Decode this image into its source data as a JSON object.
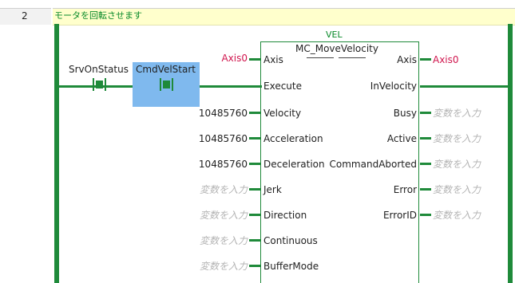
{
  "rung": {
    "number": "2",
    "comment": "モータを回転させます"
  },
  "contacts": [
    {
      "name": "SrvOnStatus",
      "selected": false
    },
    {
      "name": "CmdVelStart",
      "selected": true
    }
  ],
  "function_block": {
    "category": "VEL",
    "name": "MC_MoveVelocity",
    "inputs": [
      {
        "label": "Axis",
        "value": "Axis0",
        "kind": "axis"
      },
      {
        "label": "Execute",
        "value": "",
        "kind": "wire"
      },
      {
        "label": "Velocity",
        "value": "10485760",
        "kind": "value"
      },
      {
        "label": "Acceleration",
        "value": "10485760",
        "kind": "value"
      },
      {
        "label": "Deceleration",
        "value": "10485760",
        "kind": "value"
      },
      {
        "label": "Jerk",
        "value": "変数を入力",
        "kind": "placeholder"
      },
      {
        "label": "Direction",
        "value": "変数を入力",
        "kind": "placeholder"
      },
      {
        "label": "Continuous",
        "value": "変数を入力",
        "kind": "placeholder"
      },
      {
        "label": "BufferMode",
        "value": "変数を入力",
        "kind": "placeholder"
      }
    ],
    "outputs": [
      {
        "label": "Axis",
        "value": "Axis0",
        "kind": "axis"
      },
      {
        "label": "InVelocity",
        "value": "",
        "kind": "wire"
      },
      {
        "label": "Busy",
        "value": "変数を入力",
        "kind": "placeholder"
      },
      {
        "label": "Active",
        "value": "変数を入力",
        "kind": "placeholder"
      },
      {
        "label": "CommandAborted",
        "value": "変数を入力",
        "kind": "placeholder"
      },
      {
        "label": "Error",
        "value": "変数を入力",
        "kind": "placeholder"
      },
      {
        "label": "ErrorID",
        "value": "変数を入力",
        "kind": "placeholder"
      }
    ]
  },
  "colors": {
    "rail": "#1f8a3a",
    "comment_bg": "#ffffcc",
    "selection_bg": "#7fb9ee",
    "axis_var": "#d0164e",
    "placeholder": "#b4b4b4"
  }
}
